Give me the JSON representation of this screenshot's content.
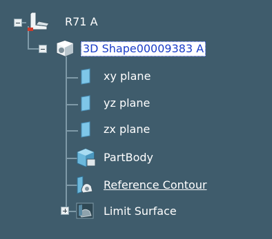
{
  "tree": {
    "root": {
      "label": "R71 A",
      "expanded": true
    },
    "part": {
      "label": "3D Shape00009383 A",
      "expanded": true,
      "selected": true
    },
    "children": [
      {
        "label": "xy plane",
        "icon": "plane-icon"
      },
      {
        "label": "yz plane",
        "icon": "plane-icon"
      },
      {
        "label": "zx plane",
        "icon": "plane-icon"
      },
      {
        "label": "PartBody",
        "icon": "body-icon"
      },
      {
        "label": "Reference Contour",
        "icon": "geoset-icon"
      },
      {
        "label": "Limit Surface",
        "icon": "geoset-icon",
        "expanded": false
      }
    ]
  }
}
